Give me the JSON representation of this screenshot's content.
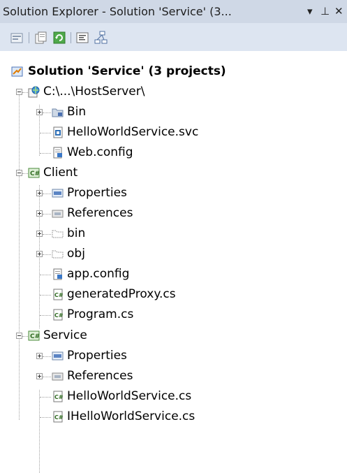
{
  "window": {
    "title": "Solution Explorer - Solution 'Service' (3...",
    "dropdown_glyph": "▾",
    "pin_glyph": "⊥",
    "close_glyph": "✕"
  },
  "toolbar": {
    "tools": [
      "properties-icon",
      "show-all-files-icon",
      "refresh-icon",
      "view-code-icon",
      "class-diagram-icon"
    ]
  },
  "tree": {
    "solution": "Solution 'Service' (3 projects)",
    "host": {
      "label": "C:\\...\\HostServer\\",
      "items": [
        "Bin",
        "HelloWorldService.svc",
        "Web.config"
      ]
    },
    "client": {
      "label": "Client",
      "items": [
        "Properties",
        "References",
        "bin",
        "obj",
        "app.config",
        "generatedProxy.cs",
        "Program.cs"
      ]
    },
    "service": {
      "label": "Service",
      "items": [
        "Properties",
        "References",
        "HelloWorldService.cs",
        "IHelloWorldService.cs"
      ]
    }
  }
}
